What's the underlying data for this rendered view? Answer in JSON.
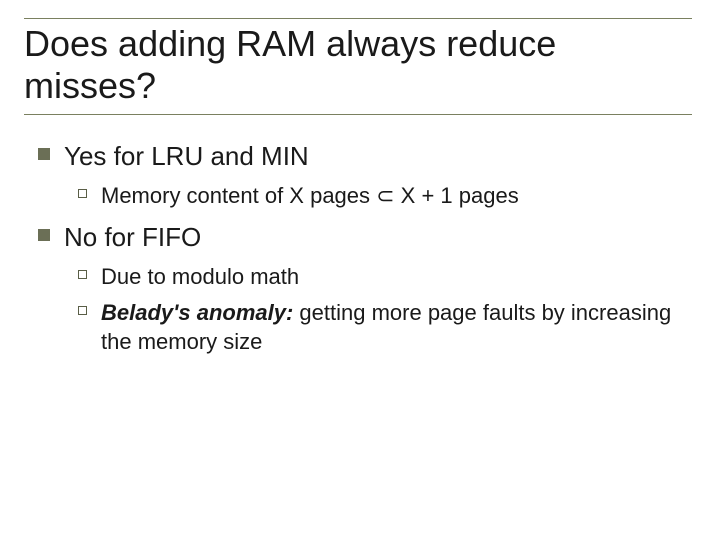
{
  "title": "Does adding RAM always reduce misses?",
  "p1": {
    "text": "Yes for LRU and MIN"
  },
  "p1_1": {
    "text": "Memory content of X pages ⊂ X + 1 pages"
  },
  "p2": {
    "text": "No for FIFO"
  },
  "p2_1": {
    "text": "Due to modulo math"
  },
  "p2_2a": "Belady's anomaly:",
  "p2_2b": "  getting more page faults by increasing the memory size"
}
